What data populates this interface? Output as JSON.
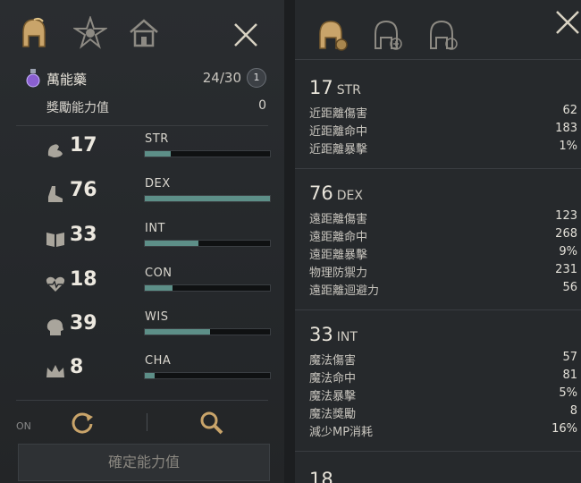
{
  "left_panel": {
    "elixir": {
      "name": "萬能藥",
      "count": "24/30",
      "badge": "1"
    },
    "bonus": {
      "label": "獎勵能力值",
      "value": "0"
    },
    "stats": [
      {
        "code": "STR",
        "value": "17",
        "fill": 0.21,
        "icon": "bicep-icon"
      },
      {
        "code": "DEX",
        "value": "76",
        "fill": 1.0,
        "icon": "boot-icon"
      },
      {
        "code": "INT",
        "value": "33",
        "fill": 0.43,
        "icon": "book-icon"
      },
      {
        "code": "CON",
        "value": "18",
        "fill": 0.22,
        "icon": "heartbeat-icon"
      },
      {
        "code": "WIS",
        "value": "39",
        "fill": 0.52,
        "icon": "head-mind-icon"
      },
      {
        "code": "CHA",
        "value": "8",
        "fill": 0.08,
        "icon": "crown-icon"
      }
    ],
    "toggle_label": "ON",
    "confirm_label": "確定能力值"
  },
  "right_panel": {
    "groups": [
      {
        "value": "17",
        "code": "STR",
        "rows": [
          {
            "label": "近距離傷害",
            "value": "62"
          },
          {
            "label": "近距離命中",
            "value": "183"
          },
          {
            "label": "近距離暴擊",
            "value": "1%"
          }
        ]
      },
      {
        "value": "76",
        "code": "DEX",
        "rows": [
          {
            "label": "遠距離傷害",
            "value": "123"
          },
          {
            "label": "遠距離命中",
            "value": "268"
          },
          {
            "label": "遠距離暴擊",
            "value": "9%"
          },
          {
            "label": "物理防禦力",
            "value": "231"
          },
          {
            "label": "遠距離迴避力",
            "value": "56"
          }
        ]
      },
      {
        "value": "33",
        "code": "INT",
        "rows": [
          {
            "label": "魔法傷害",
            "value": "57"
          },
          {
            "label": "魔法命中",
            "value": "81"
          },
          {
            "label": "魔法暴擊",
            "value": "5%"
          },
          {
            "label": "魔法獎勵",
            "value": "8"
          },
          {
            "label": "減少MP消耗",
            "value": "16%"
          }
        ]
      }
    ]
  },
  "colors": {
    "bar_fill": "#5d8f88",
    "gold": "#c9a46a"
  }
}
